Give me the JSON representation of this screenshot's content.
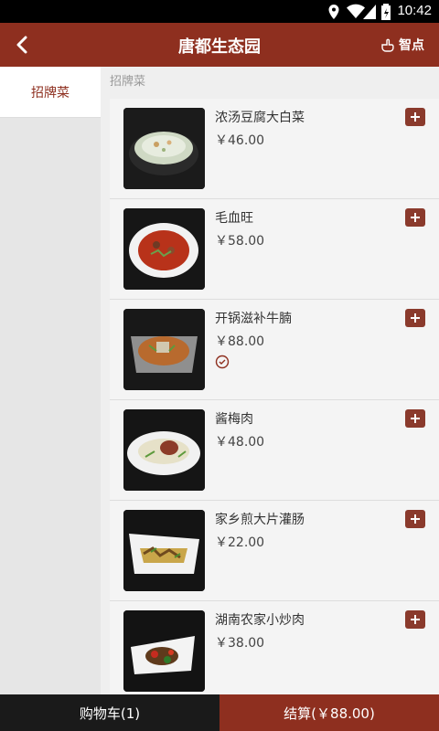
{
  "status_bar": {
    "time": "10:42",
    "icons": [
      "location-icon",
      "wifi-icon",
      "signal-icon",
      "battery-icon"
    ]
  },
  "app_bar": {
    "title": "唐都生态园",
    "smart_label": "智点"
  },
  "sidebar": {
    "categories": [
      {
        "label": "招牌菜",
        "selected": true
      }
    ]
  },
  "content": {
    "section_title": "招牌菜",
    "items": [
      {
        "name": "浓汤豆腐大白菜",
        "price": "￥46.00",
        "selected": false
      },
      {
        "name": "毛血旺",
        "price": "￥58.00",
        "selected": false
      },
      {
        "name": "开锅滋补牛腩",
        "price": "￥88.00",
        "selected": true
      },
      {
        "name": "酱梅肉",
        "price": "￥48.00",
        "selected": false
      },
      {
        "name": "家乡煎大片灌肠",
        "price": "￥22.00",
        "selected": false
      },
      {
        "name": "湖南农家小炒肉",
        "price": "￥38.00",
        "selected": false
      }
    ]
  },
  "bottom_bar": {
    "cart_label": "购物车(1)",
    "checkout_label": "结算(￥88.00)"
  },
  "colors": {
    "brand": "#8e2f1f",
    "add_button": "#8a3a2c",
    "bottom_dark": "#1a1a1a"
  }
}
